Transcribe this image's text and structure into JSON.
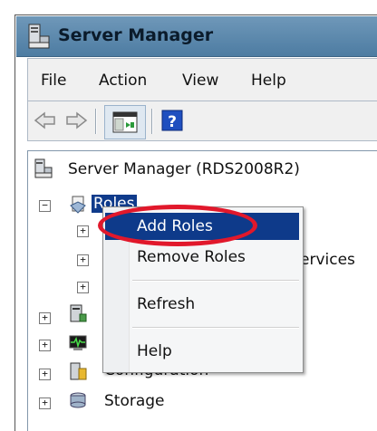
{
  "window": {
    "title": "Server Manager"
  },
  "menu": [
    "File",
    "Action",
    "View",
    "Help"
  ],
  "toolbar": {
    "icons": [
      "back-arrow-icon",
      "forward-arrow-icon",
      "show-hide-console-tree-icon",
      "help-icon"
    ]
  },
  "tree": {
    "root": "Server Manager (RDS2008R2)",
    "roles": "Roles",
    "partial_text": "ervices",
    "configuration": "Configuration",
    "storage": "Storage"
  },
  "context_menu": {
    "items": [
      "Add Roles",
      "Remove Roles",
      "Refresh",
      "Help"
    ],
    "highlighted": "Add Roles"
  },
  "colors": {
    "selection": "#0e3a8a",
    "annotation": "#e1182b",
    "titlebar": "#5a87ac"
  }
}
